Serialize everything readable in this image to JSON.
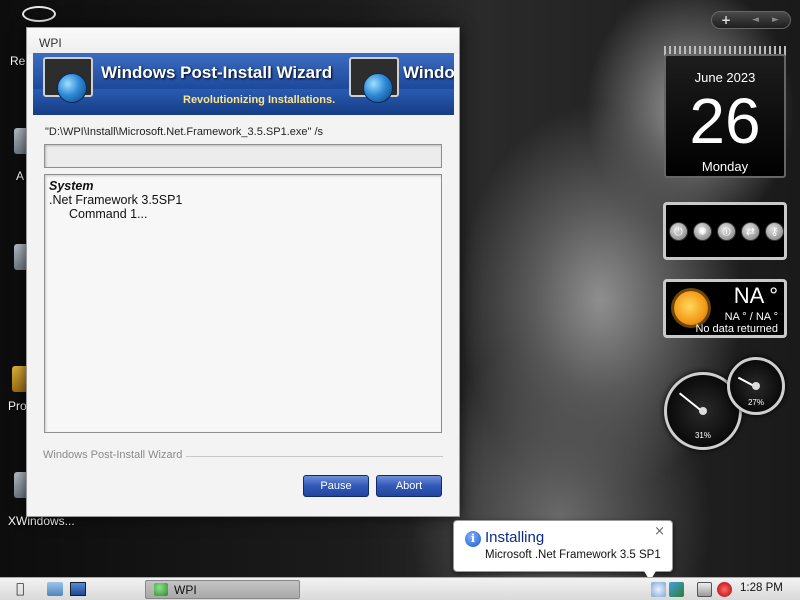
{
  "desktop": {
    "icons": [
      {
        "label": "Rec"
      },
      {
        "label": "A"
      },
      {
        "label": "Pro"
      },
      {
        "label": "XWindows..."
      }
    ]
  },
  "window": {
    "title": "WPI",
    "banner": {
      "title": "Windows Post-Install Wizard",
      "title_repeat": "Windo",
      "subtitle": "Revolutionizing Installations."
    },
    "command": "\"D:\\WPI\\Install\\Microsoft.Net.Framework_3.5.SP1.exe\" /s",
    "progress": 0,
    "log": {
      "category": "System",
      "item": ".Net Framework 3.5SP1",
      "command": "Command 1..."
    },
    "footer_label": "Windows Post-Install Wizard",
    "buttons": {
      "pause": "Pause",
      "abort": "Abort"
    }
  },
  "gadgets": {
    "top_controls": {
      "add": "+",
      "prev": "◄",
      "next": "►"
    },
    "calendar": {
      "month_year": "June 2023",
      "day": "26",
      "weekday": "Monday"
    },
    "controls": {
      "icons": [
        "power-icon",
        "settings-icon",
        "shutdown-icon",
        "switch-icon",
        "key-icon"
      ]
    },
    "weather": {
      "temp": "NA °",
      "range": "NA ° / NA °",
      "status": "No data returned"
    },
    "meters": {
      "cpu_pct_label": "31%",
      "cpu_pct": 31,
      "mem_pct_label": "27%",
      "mem_pct": 27
    }
  },
  "notification": {
    "title": "Installing",
    "text": "Microsoft .Net Framework 3.5 SP1",
    "close": "×"
  },
  "taskbar": {
    "task_label": "WPI",
    "clock": "1:28 PM"
  },
  "colors": {
    "banner_blue": "#1e4b9e",
    "button_blue": "#3359b8",
    "balloon_title": "#0a2a8c"
  }
}
